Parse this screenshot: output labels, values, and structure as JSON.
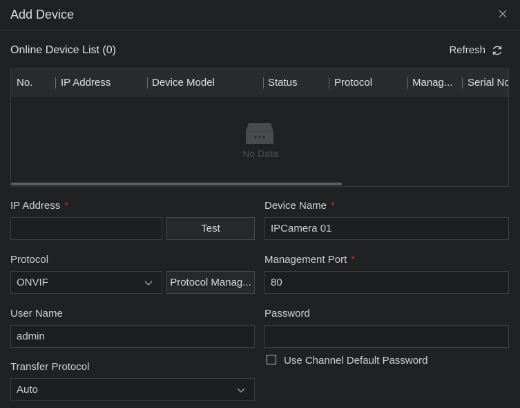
{
  "dialog": {
    "title": "Add Device"
  },
  "online_list": {
    "title": "Online Device List (0)",
    "refresh_label": "Refresh",
    "columns": [
      "No.",
      "IP Address",
      "Device Model",
      "Status",
      "Protocol",
      "Manag...",
      "Serial No"
    ],
    "empty_text": "No Data"
  },
  "form": {
    "ip_address": {
      "label": "IP Address",
      "required": "*",
      "value": ""
    },
    "test_label": "Test",
    "device_name": {
      "label": "Device Name",
      "required": "*",
      "value": "IPCamera 01"
    },
    "protocol": {
      "label": "Protocol",
      "value": "ONVIF"
    },
    "protocol_manage_label": "Protocol Manag...",
    "management_port": {
      "label": "Management Port",
      "required": "*",
      "value": "80"
    },
    "user_name": {
      "label": "User Name",
      "value": "admin"
    },
    "password": {
      "label": "Password",
      "value": ""
    },
    "use_default_password_label": "Use Channel Default Password",
    "use_default_password_checked": false,
    "transfer_protocol": {
      "label": "Transfer Protocol",
      "value": "Auto"
    }
  },
  "colors": {
    "background": "#202123",
    "required": "#c62a2a",
    "header_row": "#2a2b2e"
  },
  "icons": [
    "close-icon",
    "refresh-icon",
    "empty-box-icon",
    "chevron-down-icon"
  ]
}
